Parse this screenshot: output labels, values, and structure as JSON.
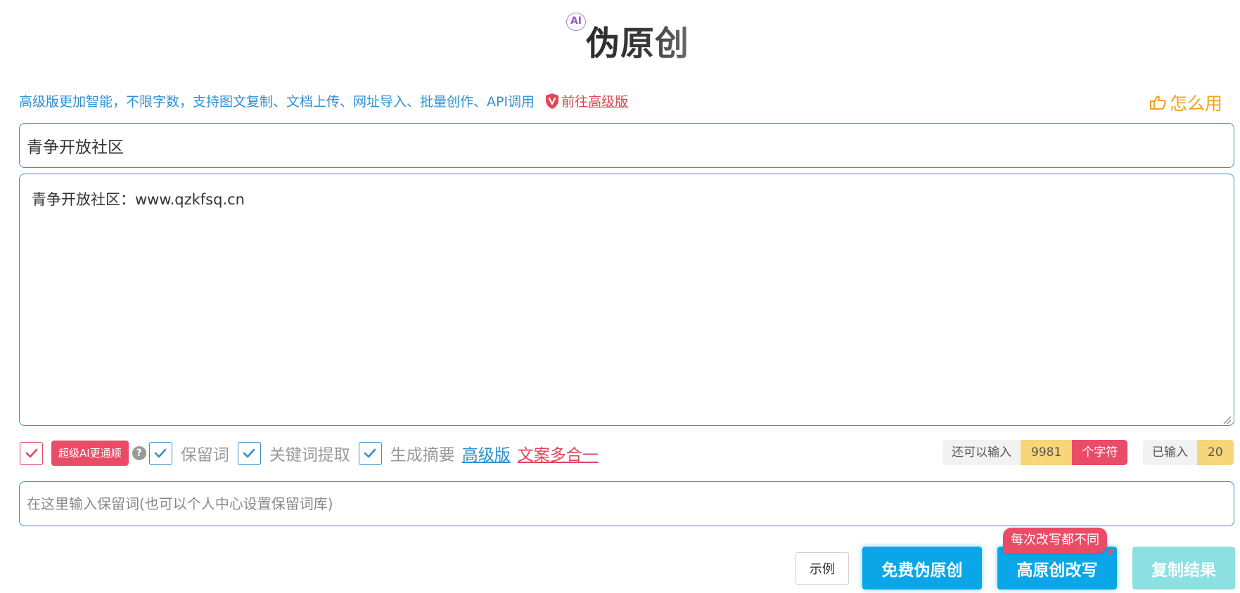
{
  "header": {
    "ai_badge": "AI",
    "title": "伪原创"
  },
  "promo": {
    "text": "高级版更加智能，不限字数，支持图文复制、文档上传、网址导入、批量创作、API调用",
    "goto_prefix": "前往",
    "goto_link": "高级版",
    "howto": "怎么用"
  },
  "editor": {
    "title_value": "青争开放社区",
    "content_value": "青争开放社区：www.qzkfsq.cn"
  },
  "options": {
    "ai_tag": "超级AI更通顺",
    "help": "?",
    "keep_words": "保留词",
    "keyword_extract": "关键词提取",
    "summary": "生成摘要",
    "advanced_link": "高级版",
    "combo_link": "文案多合一"
  },
  "counters": {
    "remaining_label": "还可以输入",
    "remaining_value": "9981",
    "remaining_unit": "个字符",
    "entered_label": "已输入",
    "entered_value": "20"
  },
  "keep_input": {
    "placeholder": "在这里输入保留词(也可以个人中心设置保留词库)"
  },
  "actions": {
    "example": "示例",
    "free_rewrite": "免费伪原创",
    "high_rewrite": "高原创改写",
    "tooltip": "每次改写都不同",
    "copy_result": "复制结果"
  },
  "colors": {
    "primary_blue": "#0aa6e8",
    "border_blue": "#3a8fc8",
    "link_blue": "#2f8fd0",
    "accent_red": "#ea4c68",
    "howto_orange": "#f0a020",
    "count_yellow": "#f7d579",
    "copy_disabled": "#8de0e2"
  },
  "icons": [
    "shield-icon",
    "hand-point-icon",
    "check-icon",
    "help-icon",
    "resize-grip-icon"
  ]
}
